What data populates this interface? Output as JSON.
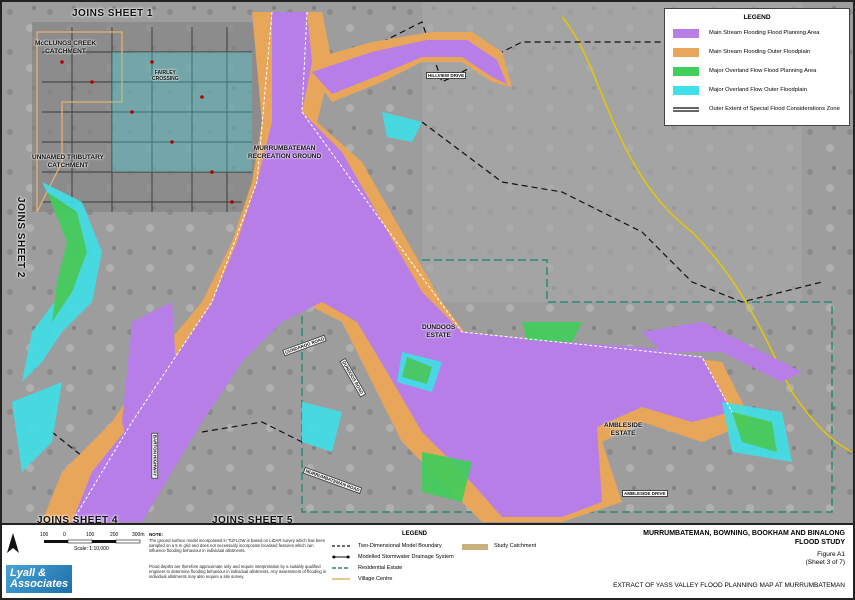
{
  "map": {
    "joins_top": "JOINS SHEET 1",
    "joins_left": "JOINS SHEET 2",
    "joins_bottom_left": "JOINS SHEET 4",
    "joins_bottom_right": "JOINS SHEET 5",
    "areas": {
      "mcclungs": "McCLUNGS CREEK\nCATCHMENT",
      "unnamed": "UNNAMED TRIBUTARY\nCATCHMENT",
      "recreation": "MURRUMBATEMAN\nRECREATION GROUND",
      "dundoos": "DUNDOOS\nESTATE",
      "ambleside": "AMBLESIDE\nESTATE",
      "fairley": "FAIRLEY\nCROSSING"
    },
    "roads": [
      "HILLVIEW DRIVE",
      "BARTON HIGHWAY",
      "GUNDAROO ROAD",
      "MURRUMBATEMAN ROAD",
      "AMBLESIDE DRIVE",
      "DUNDOOS ROAD"
    ]
  },
  "legend": {
    "title": "LEGEND",
    "items": [
      {
        "label": "Main Stream Flooding Flood Planning Area",
        "color": "#b77ee8"
      },
      {
        "label": "Main Stream Flooding Outer Floodplain",
        "color": "#e8a65a"
      },
      {
        "label": "Major Overland Flow Flood Planning Area",
        "color": "#3fcf5a"
      },
      {
        "label": "Major Overland Flow Outer Floodplain",
        "color": "#3fe0e8"
      },
      {
        "label": "Outer Extent of Special Flood Considerations Zone",
        "color": "#888888"
      }
    ]
  },
  "scale": {
    "ticks": [
      "100",
      "0",
      "100",
      "200",
      "300m"
    ],
    "label": "Scale: 1:10,000"
  },
  "note": {
    "title": "NOTE:",
    "text1": "The ground surface model incorporated in TUFLOW is based on LiDAR survey which has been sampled on a 5 m grid and does not necessarily incorporate localised features which can influence flooding behaviour in individual allotments.",
    "text2": "Flood depths are therefore approximate only and require interpretation by a suitably qualified engineer to determine flooding behaviour in individual allotments. Any assessment of flooding in individual allotments may also require a site survey."
  },
  "bottom_legend": {
    "title": "LEGEND",
    "items": [
      "Two-Dimensional Model Boundary",
      "Modelled Stormwater Drainage System",
      "Residential Estate",
      "Village Centre"
    ],
    "catchment": "Study Catchment"
  },
  "logo": {
    "line1": "Lyall &",
    "line2": "Associates"
  },
  "title_block": {
    "title1": "MURRUMBATEMAN, BOWNING, BOOKHAM AND BINALONG",
    "title2": "FLOOD STUDY",
    "figure": "Figure A1",
    "sheet": "(Sheet 3 of 7)",
    "extract": "EXTRACT OF YASS VALLEY FLOOD PLANNING MAP AT MURRUMBATEMAN"
  }
}
